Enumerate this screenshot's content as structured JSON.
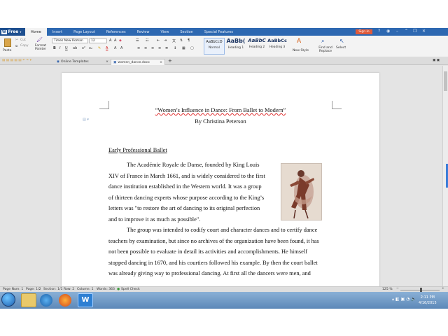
{
  "app": {
    "name": "Free",
    "menu_tabs": [
      "Home",
      "Insert",
      "Page Layout",
      "References",
      "Review",
      "View",
      "Section",
      "Special Features"
    ],
    "sign_in": "Sign in"
  },
  "ribbon": {
    "cut": "Cut",
    "copy": "Copy",
    "paste": "Paste",
    "format_painter": "Format Painter",
    "font_name": "Times New Roman",
    "font_size": "12",
    "styles": [
      {
        "sample": "AaBbCcD",
        "name": "Normal"
      },
      {
        "sample": "AaBb(",
        "name": "Heading 1"
      },
      {
        "sample": "AaBbC",
        "name": "Heading 2"
      },
      {
        "sample": "AaBbCc",
        "name": "Heading 3"
      }
    ],
    "new_style": "New Style",
    "find_replace": "Find and Replace",
    "select": "Select"
  },
  "tabs": {
    "online_templates": "Online Templates",
    "document": "women_dance.docx"
  },
  "document": {
    "title": "“Women’s Influence in Dance: From Ballet to Modern”",
    "byline": "By Christina Peterson",
    "heading": "Early Professional Ballet",
    "para1_lines": [
      "The Académie Royale de Danse, founded by King Louis",
      "XIV of France in March 1661, and is widely considered to the first",
      "dance institution established in the Western world. It was a group",
      "of thirteen dancing experts whose purpose according to the King’s",
      "letters was \"to restore the art of dancing to its original perfection",
      "and to improve it as much as possible\"."
    ],
    "para2_lines": [
      "The group was intended to codify court and character dances and to certify dance",
      "teachers by examination, but since no archives of the organization have been found, it has",
      "not been possible to evaluate in detail its activities and accomplishments. He himself",
      "stopped dancing in 1670, and his courtiers followed his example. By then the court ballet",
      "was already giving way to professional dancing. At first all the dancers were men, and"
    ]
  },
  "status": {
    "page_num": "Page Num: 1",
    "page": "Page: 1/2",
    "section": "Section: 1/1",
    "row": "Row: 2",
    "column": "Column: 1",
    "words": "Words: 363",
    "spell_check": "Spell Check",
    "zoom": "125 %"
  },
  "clock": {
    "time": "2:11 PM",
    "date": "4/16/2015"
  },
  "colors": {
    "menubar": "#2d68b1",
    "accent": "#3b7dd8",
    "sign_in": "#e05a3a",
    "spell_error": "#e03030"
  }
}
